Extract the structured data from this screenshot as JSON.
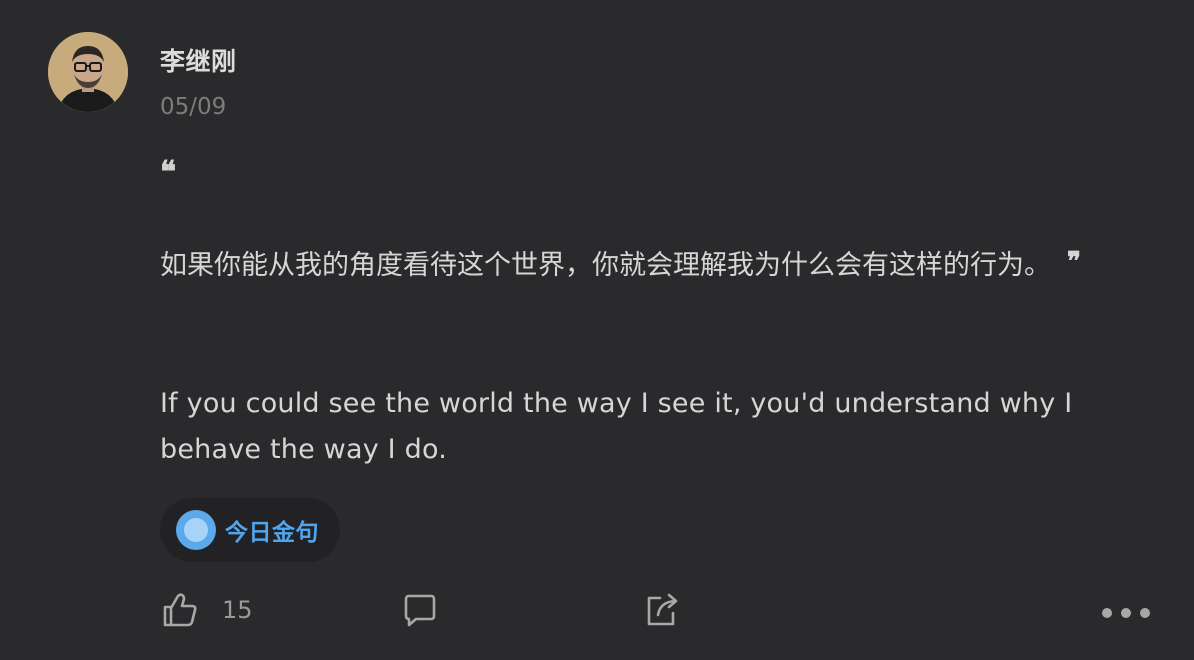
{
  "post": {
    "author": "李继刚",
    "date": "05/09",
    "quote_open": "❝",
    "quote_close": "❞",
    "text_cn": "如果你能从我的角度看待这个世界，你就会理解我为什么会有这样的行为。",
    "text_en": "If you could see the world the way I see it, you'd understand why I behave the way I do."
  },
  "tag": {
    "label": "今日金句",
    "icon": "circle-topic-icon",
    "color": "#4fa6f0"
  },
  "actions": {
    "like_icon": "thumbs-up-icon",
    "like_count": "15",
    "comment_icon": "comment-icon",
    "share_icon": "share-icon",
    "more_icon": "more-dots-icon"
  },
  "theme": {
    "background": "#2a2a2c",
    "accent": "#4fa6f0"
  }
}
